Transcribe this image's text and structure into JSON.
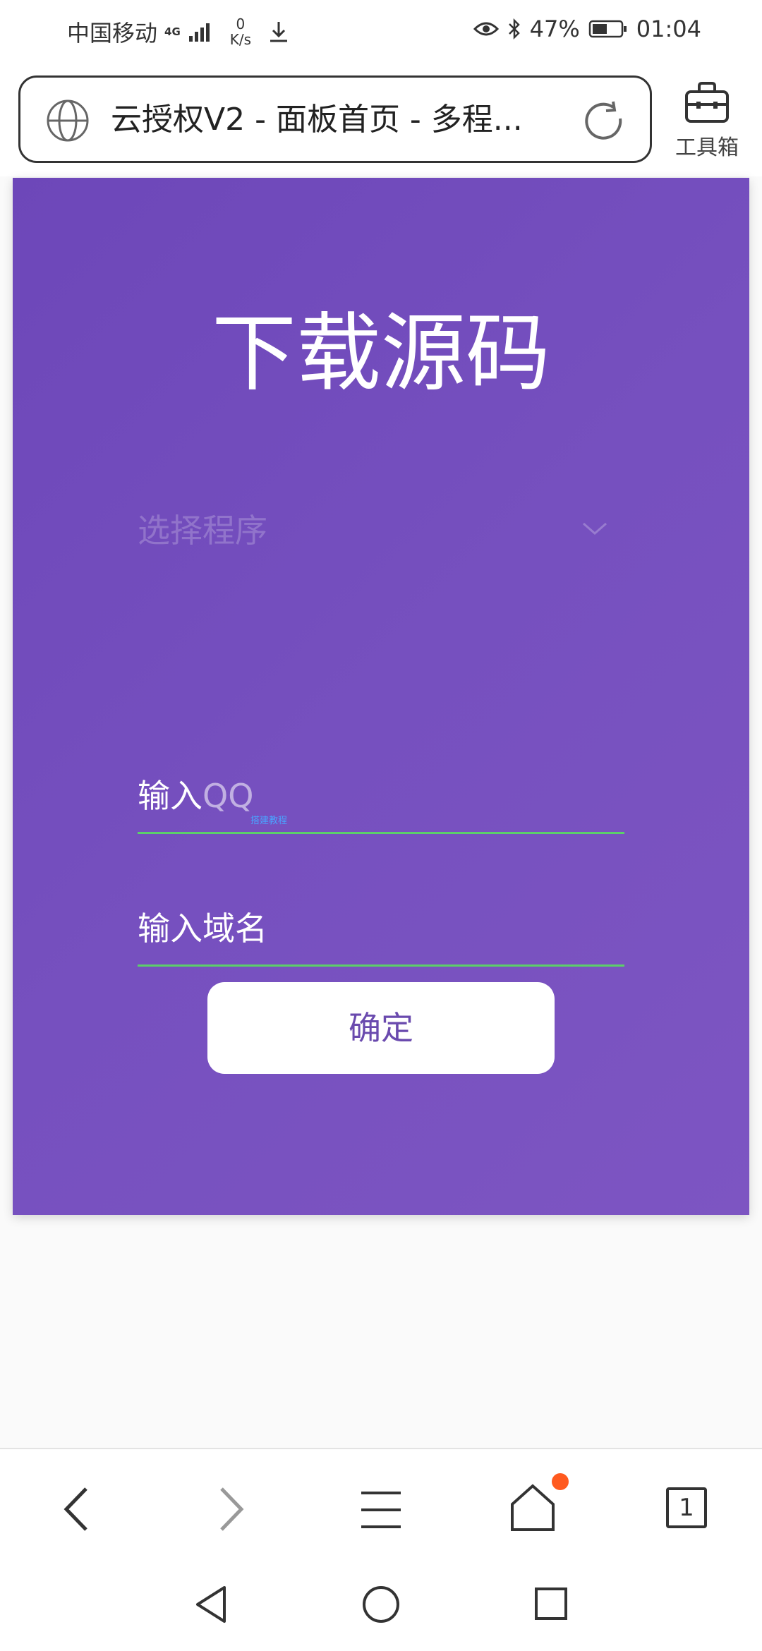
{
  "status_bar": {
    "carrier": "中国移动",
    "network": "4G",
    "speed_value": "0",
    "speed_unit": "K/s",
    "battery": "47%",
    "time": "01:04"
  },
  "browser": {
    "page_title": "云授权V2 - 面板首页 - 多程...",
    "toolbox_label": "工具箱"
  },
  "form": {
    "heading": "下载源码",
    "select_placeholder": "选择程序",
    "qq_label": "输入",
    "qq_placeholder": "QQ",
    "domain_label": "输入域名",
    "tiny_link": "搭建教程",
    "confirm_label": "确定"
  },
  "bottom_nav": {
    "tab_count": "1"
  },
  "colors": {
    "card_purple": "#7650bf",
    "underline_green": "#5ccf6a",
    "badge_orange": "#ff5a1f",
    "button_text": "#6a4aae"
  }
}
